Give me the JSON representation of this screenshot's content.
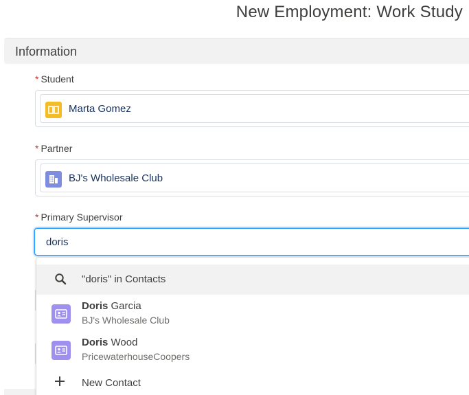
{
  "header": {
    "title": "New Employment: Work Study"
  },
  "section": {
    "title": "Information"
  },
  "fields": {
    "student": {
      "required_mark": "*",
      "label": "Student",
      "value": "Marta Gomez",
      "icon": "book-icon",
      "icon_color": "#f4bc25"
    },
    "partner": {
      "required_mark": "*",
      "label": "Partner",
      "value": "BJ's Wholesale Club",
      "icon": "building-icon",
      "icon_color": "#7f8de1"
    },
    "primary_supervisor": {
      "required_mark": "*",
      "label": "Primary Supervisor",
      "value": "doris"
    }
  },
  "dropdown": {
    "search_label": "\"doris\" in Contacts",
    "results": [
      {
        "match": "Doris",
        "rest": " Garcia",
        "subtitle": "BJ's Wholesale Club",
        "icon": "contact-card-icon"
      },
      {
        "match": "Doris",
        "rest": " Wood",
        "subtitle": "PricewaterhouseCoopers",
        "icon": "contact-card-icon"
      }
    ],
    "new_label": "New Contact"
  },
  "colors": {
    "required": "#c23934",
    "focus": "#1b96ff",
    "contact_icon": "#9f8fef",
    "section_bg": "#f3f2f2"
  }
}
